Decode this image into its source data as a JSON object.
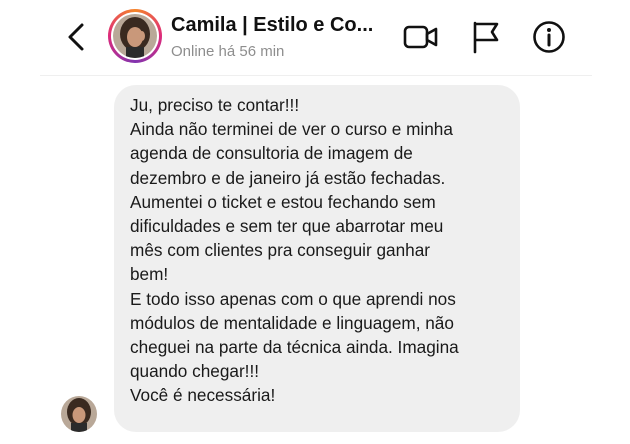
{
  "header": {
    "back_icon": "chevron-left-icon",
    "contact_name": "Camila | Estilo e Co...",
    "status": "Online há 56 min",
    "actions": [
      "video-call-icon",
      "flag-icon",
      "info-icon"
    ]
  },
  "message": {
    "lines": [
      "Ju, preciso te contar!!!",
      "Ainda não terminei de ver o curso e minha",
      "agenda de consultoria de imagem de",
      "dezembro e de janeiro já estão fechadas.",
      "Aumentei o ticket e estou fechando sem",
      "dificuldades e sem ter que abarrotar meu",
      "mês com clientes pra conseguir ganhar",
      "bem!",
      "E todo isso apenas com o que aprendi nos",
      "módulos de mentalidade e linguagem, não",
      "cheguei na parte da técnica ainda. Imagina",
      "quando chegar!!!",
      "Você é necessária!"
    ]
  },
  "colors": {
    "bubble": "#efefef",
    "status_text": "#8e8e8e",
    "ring_gradient": [
      "#f58529",
      "#dd2a7b",
      "#8134af"
    ]
  }
}
